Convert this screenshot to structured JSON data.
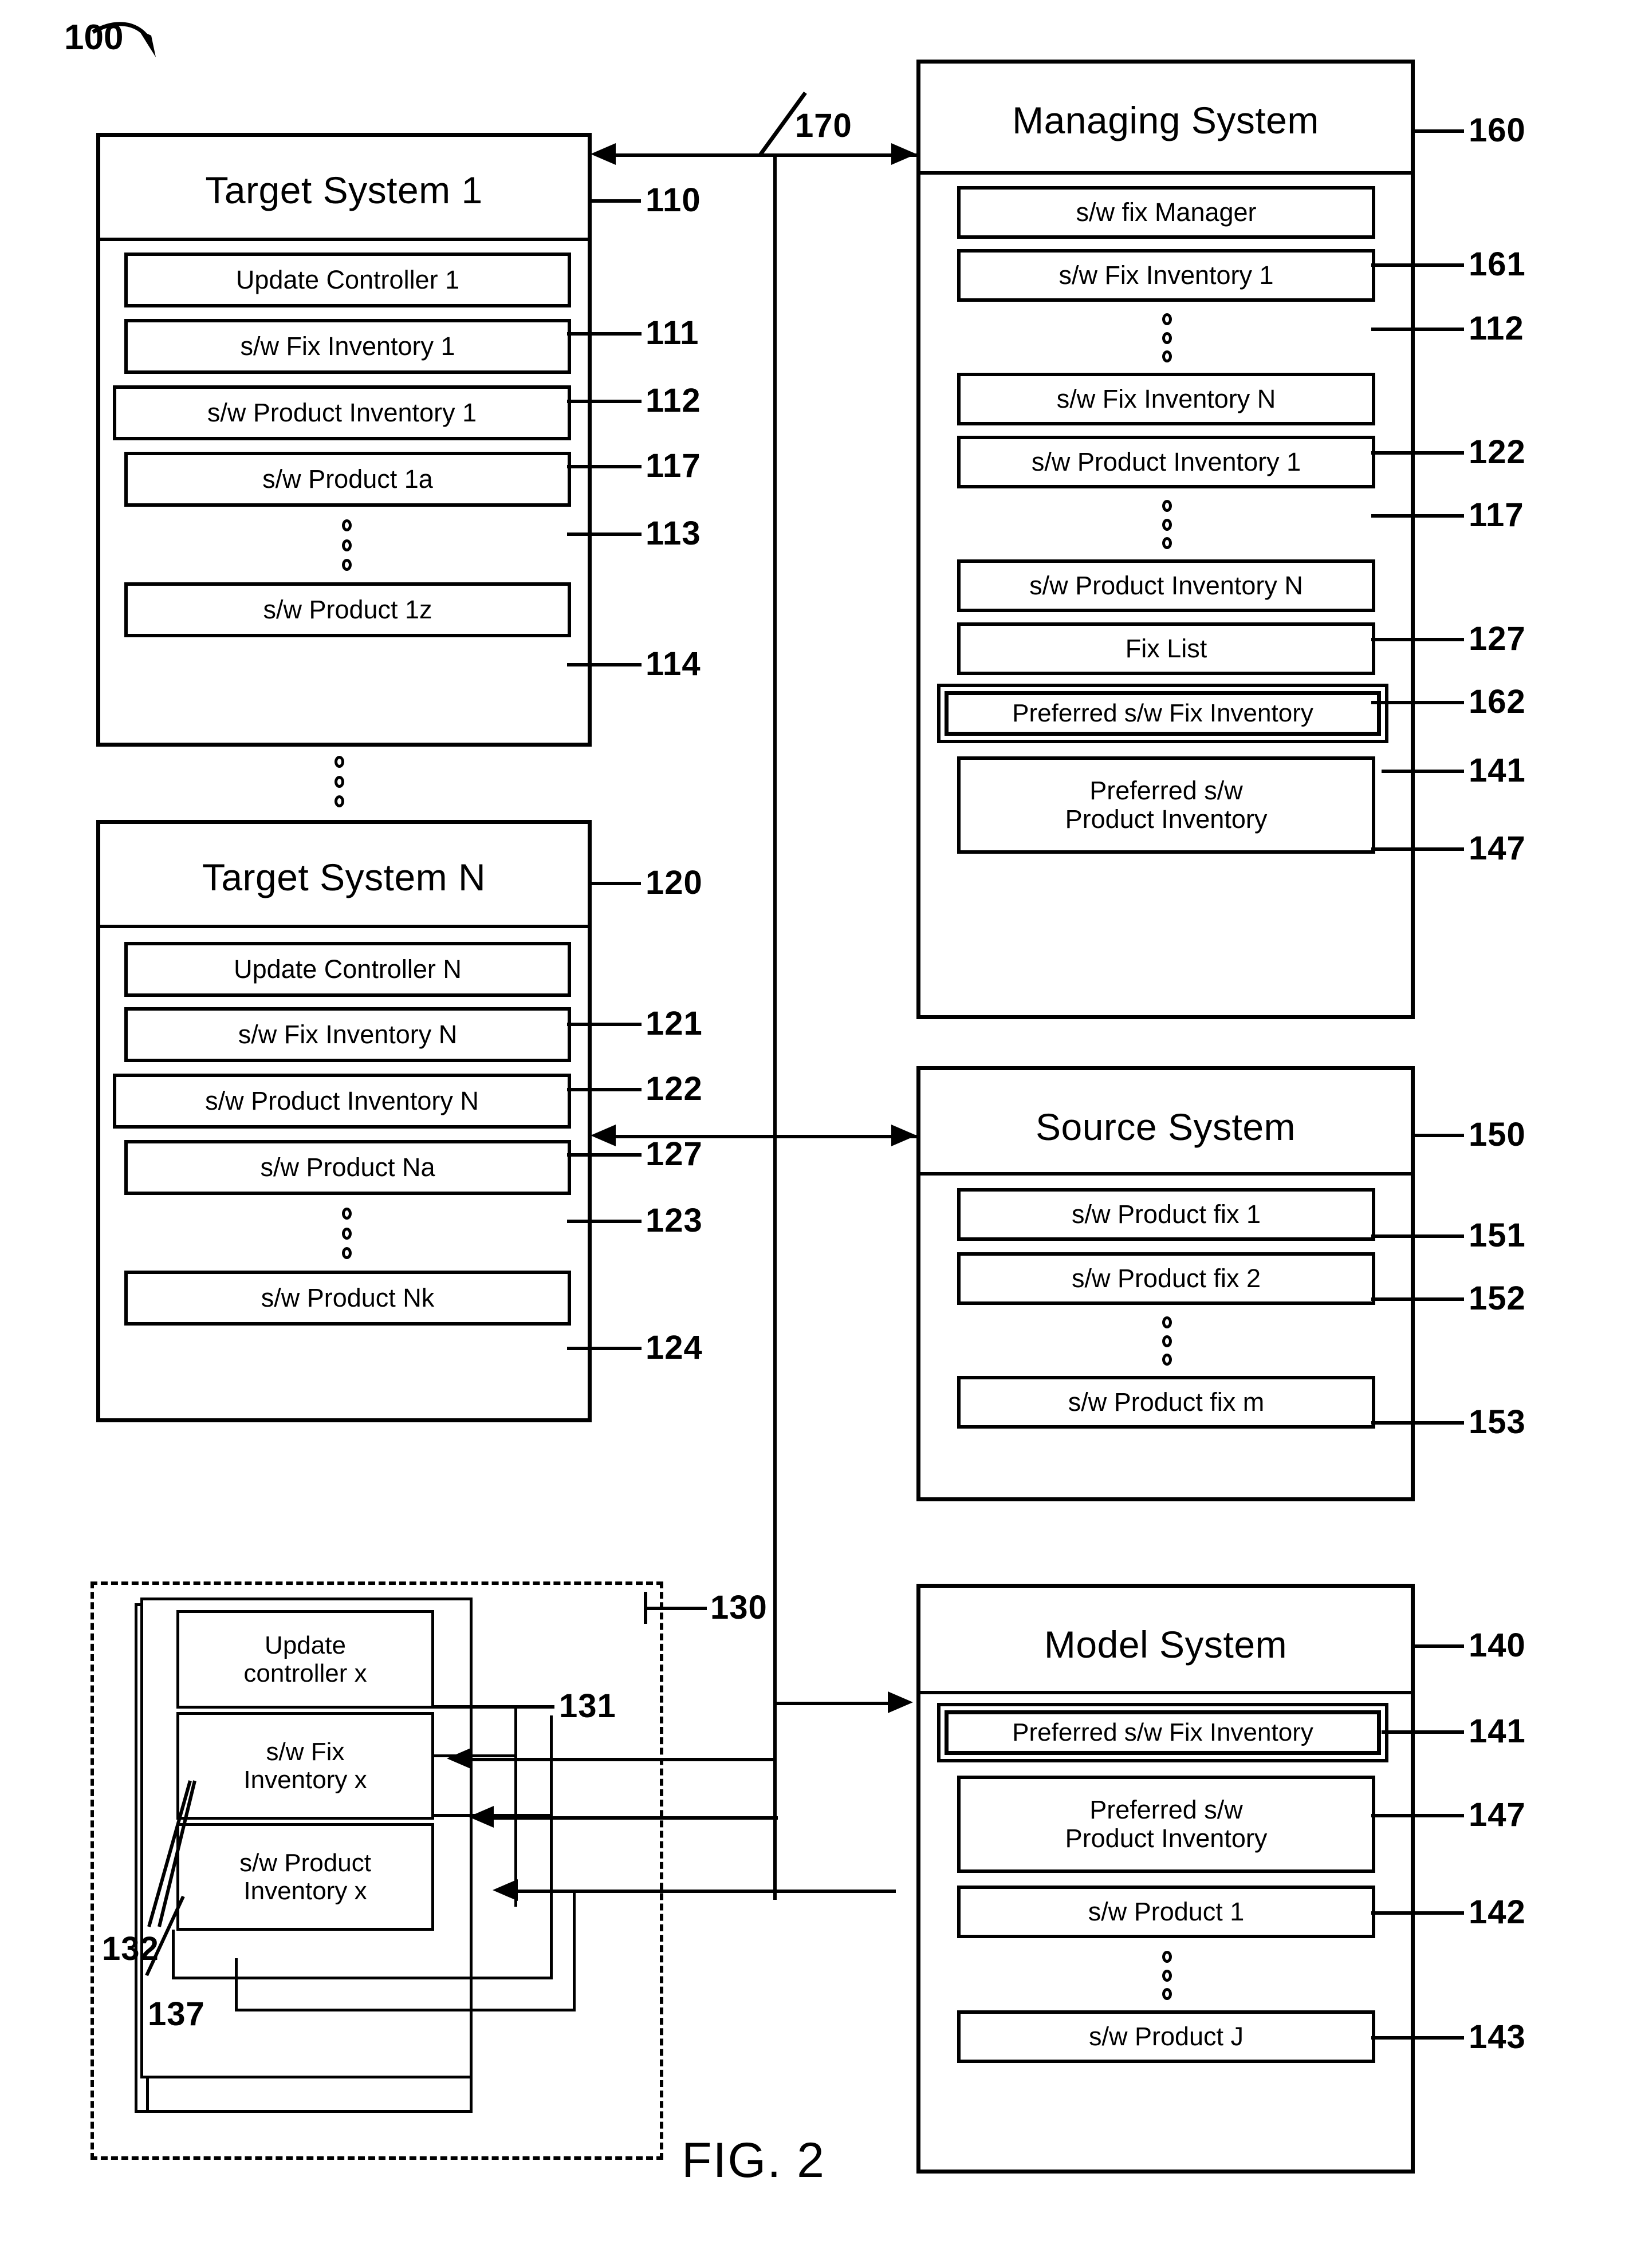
{
  "figure": {
    "caption": "FIG. 2",
    "system_tag": "100"
  },
  "target_system_1": {
    "title": "Target System 1",
    "ref": "110",
    "items": [
      {
        "label": "Update Controller 1",
        "ref": "111"
      },
      {
        "label": "s/w Fix Inventory 1",
        "ref": "112"
      },
      {
        "label": "s/w Product Inventory 1",
        "ref": "117"
      },
      {
        "label": "s/w Product 1a",
        "ref": "113"
      },
      {
        "label": "s/w Product 1z",
        "ref": "114"
      }
    ]
  },
  "target_system_n": {
    "title": "Target System N",
    "ref": "120",
    "items": [
      {
        "label": "Update Controller N",
        "ref": "121"
      },
      {
        "label": "s/w Fix Inventory N",
        "ref": "122"
      },
      {
        "label": "s/w Product Inventory N",
        "ref": "127"
      },
      {
        "label": "s/w Product Na",
        "ref": "123"
      },
      {
        "label": "s/w Product Nk",
        "ref": "124"
      }
    ]
  },
  "managing_system": {
    "title": "Managing System",
    "ref": "160",
    "items": [
      {
        "label": "s/w fix Manager",
        "ref": "161"
      },
      {
        "label": "s/w Fix Inventory 1",
        "ref": "112"
      },
      {
        "label": "s/w Fix Inventory N",
        "ref": "122"
      },
      {
        "label": "s/w Product Inventory 1",
        "ref": "117"
      },
      {
        "label": "s/w Product Inventory N",
        "ref": "127"
      },
      {
        "label": "Fix List",
        "ref": "162"
      },
      {
        "label": "Preferred s/w Fix Inventory",
        "ref": "141"
      },
      {
        "label": "Preferred s/w\nProduct Inventory",
        "ref": "147"
      }
    ]
  },
  "source_system": {
    "title": "Source System",
    "ref": "150",
    "items": [
      {
        "label": "s/w Product fix 1",
        "ref": "151"
      },
      {
        "label": "s/w Product fix 2",
        "ref": "152"
      },
      {
        "label": "s/w Product fix m",
        "ref": "153"
      }
    ]
  },
  "model_system": {
    "title": "Model System",
    "ref": "140",
    "items": [
      {
        "label": "Preferred s/w Fix Inventory",
        "ref": "141"
      },
      {
        "label": "Preferred s/w\nProduct Inventory",
        "ref": "147"
      },
      {
        "label": "s/w Product 1",
        "ref": "142"
      },
      {
        "label": "s/w Product J",
        "ref": "143"
      }
    ]
  },
  "new_system_module": {
    "ref": "130",
    "items": [
      {
        "label": "Update\ncontroller x",
        "ref": "131"
      },
      {
        "label": "s/w Fix\nInventory x",
        "ref": "132"
      },
      {
        "label": "s/w Product\nInventory x",
        "ref": "137"
      }
    ]
  },
  "network": {
    "ref": "170"
  }
}
